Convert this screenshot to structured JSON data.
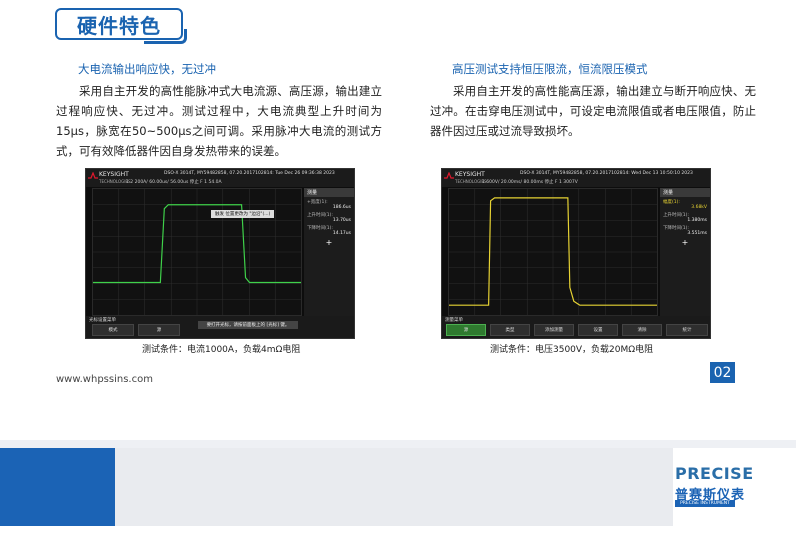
{
  "header": {
    "title": "硬件特色"
  },
  "left_column": {
    "heading": "大电流输出响应快，无过冲",
    "body": "采用自主开发的高性能脉冲式大电流源、高压源，输出建立过程响应快、无过冲。测试过程中，大电流典型上升时间为15μs，脉宽在50~500μs之间可调。采用脉冲大电流的测试方式，可有效降低器件因自身发热带来的误差。",
    "caption": "测试条件：电流1000A，负载4mΩ电阻",
    "scope": {
      "brand": "KEYSIGHT",
      "brand_sub": "TECHNOLOGIES",
      "model_line": "DSO-X 3014T, MY59482858, 07.20.2017102814: Tue Dec 26 09:36:38 2023",
      "status_line": "1   2   200A/   60.00us/  56.00us   停止   F   1   54.0A",
      "popup": "触发 位置更改为 \"边沿\"(...)",
      "side_title": "测量",
      "side_items": [
        {
          "label": "+宽度(1):",
          "value": "186.6us"
        },
        {
          "label": "上升时间(1):",
          "value": "13.70us"
        },
        {
          "label": "下降时间(1):",
          "value": "14.17us"
        }
      ],
      "soft_label": "光标设置菜单",
      "soft_keys": [
        "模式",
        "源"
      ],
      "message": "要打开光标，请按前面板上的 [光标] 键。",
      "color": "#3fd14a"
    }
  },
  "right_column": {
    "heading": "高压测试支持恒压限流，恒流限压模式",
    "body": "采用自主开发的高性能高压源，输出建立与断开响应快、无过冲。在击穿电压测试中，可设定电流限值或者电压限值，防止 器件因过压或过流导致损坏。",
    "caption": "测试条件：电压3500V，负载20MΩ电阻",
    "scope": {
      "brand": "KEYSIGHT",
      "brand_sub": "TECHNOLOGIES",
      "model_line": "DSO-X 3014T, MY59482858, 07.20.2017102814: Wed Dec 13 10:50:10 2023",
      "status_line": "1   600V/   20.00ms/   80.00ms   停止   F   1   3007V",
      "side_title": "测量",
      "side_items": [
        {
          "label": "幅度(1):",
          "value": "3.68kV"
        },
        {
          "label": "上升时间(1):",
          "value": "1.380ms"
        },
        {
          "label": "下降时间(1):",
          "value": "3.551ms"
        }
      ],
      "soft_label": "测量菜单",
      "soft_keys": [
        "源",
        "类型",
        "添加测量",
        "设置",
        "清除",
        "统计"
      ],
      "color": "#e6d233"
    }
  },
  "page_number": "02",
  "website": "www.whpssins.com",
  "footer": {
    "logo_en": "PRECISE",
    "logo_cn": "普赛斯仪表",
    "logo_sub": "PRECISE INSTRUMENT"
  }
}
